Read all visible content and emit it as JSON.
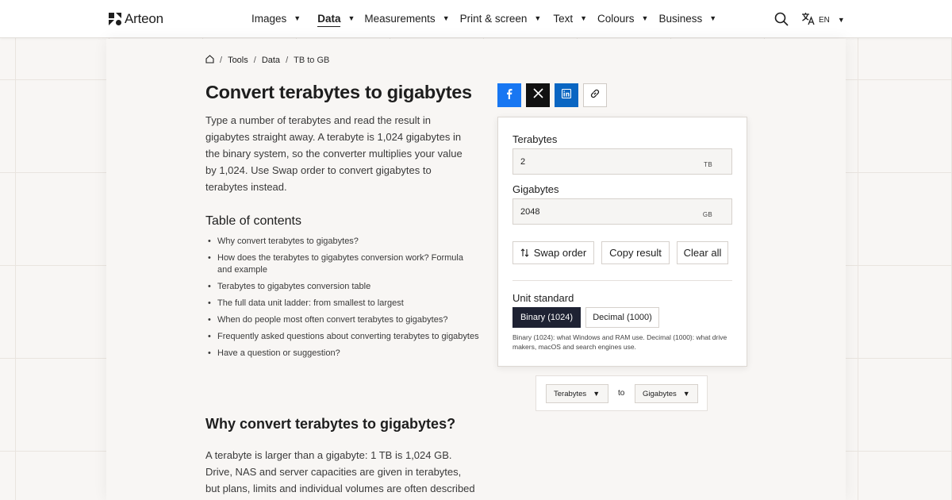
{
  "brand": {
    "name": "Arteon"
  },
  "nav": {
    "items": [
      {
        "label": "Images"
      },
      {
        "label": "Data"
      },
      {
        "label": "Measurements"
      },
      {
        "label": "Print & screen"
      },
      {
        "label": "Text"
      },
      {
        "label": "Colours"
      },
      {
        "label": "Business"
      }
    ],
    "active": "Data",
    "language": "EN"
  },
  "breadcrumb": {
    "items": [
      "Tools",
      "Data"
    ],
    "current": "TB to GB"
  },
  "page": {
    "title": "Convert terabytes to gigabytes",
    "intro": "Type a number of terabytes and read the result in gigabytes straight away. A terabyte is 1,024 gigabytes in the binary system, so the converter multiplies your value by 1,024. Use Swap order to convert gigabytes to terabytes instead."
  },
  "toc": {
    "title": "Table of contents",
    "items": [
      "Why convert terabytes to gigabytes?",
      "How does the terabytes to gigabytes conversion work? Formula and example",
      "Terabytes to gigabytes conversion table",
      "The full data unit ladder: from smallest to largest",
      "When do people most often convert terabytes to gigabytes?",
      "Frequently asked questions about converting terabytes to gigabytes",
      "Have a question or suggestion?"
    ]
  },
  "section": {
    "title": "Why convert terabytes to gigabytes?",
    "body": "A terabyte is larger than a gigabyte: 1 TB is 1,024 GB. Drive, NAS and server capacities are given in terabytes, but plans, limits and individual volumes are often described in"
  },
  "share": [
    "facebook-icon",
    "x-icon",
    "linkedin-icon",
    "link-icon"
  ],
  "converter": {
    "from": {
      "label": "Terabytes",
      "value": "2",
      "unit": "TB"
    },
    "to": {
      "label": "Gigabytes",
      "value": "2048",
      "unit": "GB"
    },
    "buttons": {
      "swap": "Swap order",
      "copy": "Copy result",
      "clear": "Clear all"
    },
    "standard": {
      "label": "Unit standard",
      "options": [
        "Binary (1024)",
        "Decimal (1000)"
      ],
      "selected": "Binary (1024)",
      "note": "Binary (1024): what Windows and RAM use. Decimal (1000): what drive makers, macOS and search engines use."
    }
  },
  "unit_select": {
    "from": "Terabytes",
    "connector": "to",
    "to": "Gigabytes"
  },
  "colors": {
    "facebook": "#1877f2",
    "x": "#111111",
    "linkedin": "#0a66c2",
    "segment_active": "#1e2233"
  }
}
